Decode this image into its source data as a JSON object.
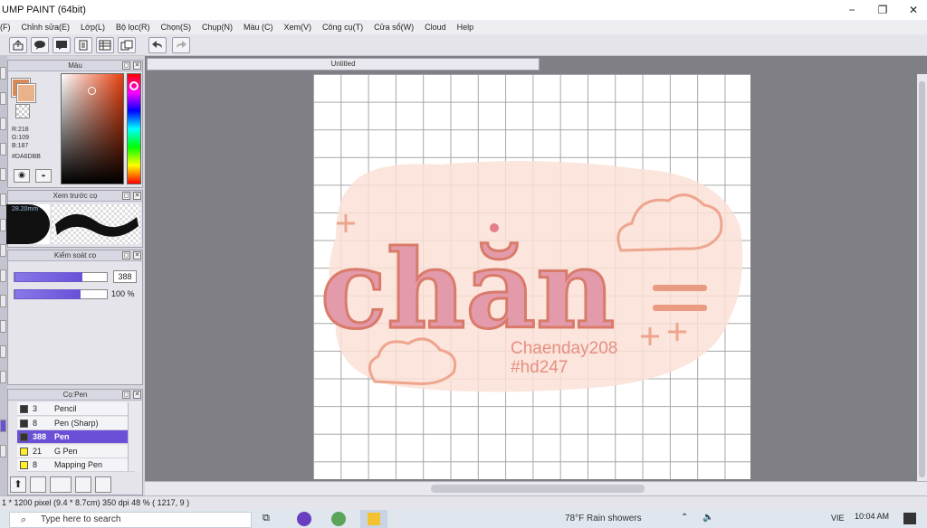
{
  "window": {
    "title": "UMP PAINT (64bit)",
    "minimize": "−",
    "maximize": "❐",
    "close": "✕"
  },
  "menu": [
    "(F)",
    "Chỉnh sửa(E)",
    "Lớp(L)",
    "Bộ lọc(R)",
    "Chọn(S)",
    "Chụp(N)",
    "Màu (C)",
    "Xem(V)",
    "Công cụ(T)",
    "Cửa sổ(W)",
    "Cloud",
    "Help"
  ],
  "color_panel": {
    "title": "Màu",
    "r": "R:218",
    "g": "G:109",
    "b": "B:187",
    "hex": "#DA6DBB",
    "main_color": "#da8a5a"
  },
  "brush_preview": {
    "title": "Xem trước cọ",
    "size_label": "28.20mm"
  },
  "brush_control": {
    "title": "Kiểm soát cọ",
    "size_value": "388",
    "opacity_value": "100 %",
    "size_fraction": 0.72,
    "opacity_fraction": 0.7
  },
  "brush_list": {
    "title": "Cọ:Pen",
    "items": [
      {
        "size": "3",
        "name": "Pencil",
        "color": "#333333",
        "selected": false
      },
      {
        "size": "8",
        "name": "Pen (Sharp)",
        "color": "#333333",
        "selected": false
      },
      {
        "size": "388",
        "name": "Pen",
        "color": "#333333",
        "selected": true
      },
      {
        "size": "21",
        "name": "G Pen",
        "color": "#ffee22",
        "selected": false
      },
      {
        "size": "8",
        "name": "Mapping Pen",
        "color": "#ffee22",
        "selected": false
      }
    ]
  },
  "document": {
    "tab": "Untitled"
  },
  "artwork": {
    "main_text": "chăn",
    "name": "Chaenday208",
    "hashtag": "#hd247"
  },
  "status": "1 * 1200 pixel  (9.4 * 8.7cm)  350 dpi  48 %  ( 1217, 9 )",
  "taskbar": {
    "search_placeholder": "Type here to search",
    "weather": "78°F  Rain showers",
    "lang": "VIE",
    "time": "10:04 AM"
  }
}
